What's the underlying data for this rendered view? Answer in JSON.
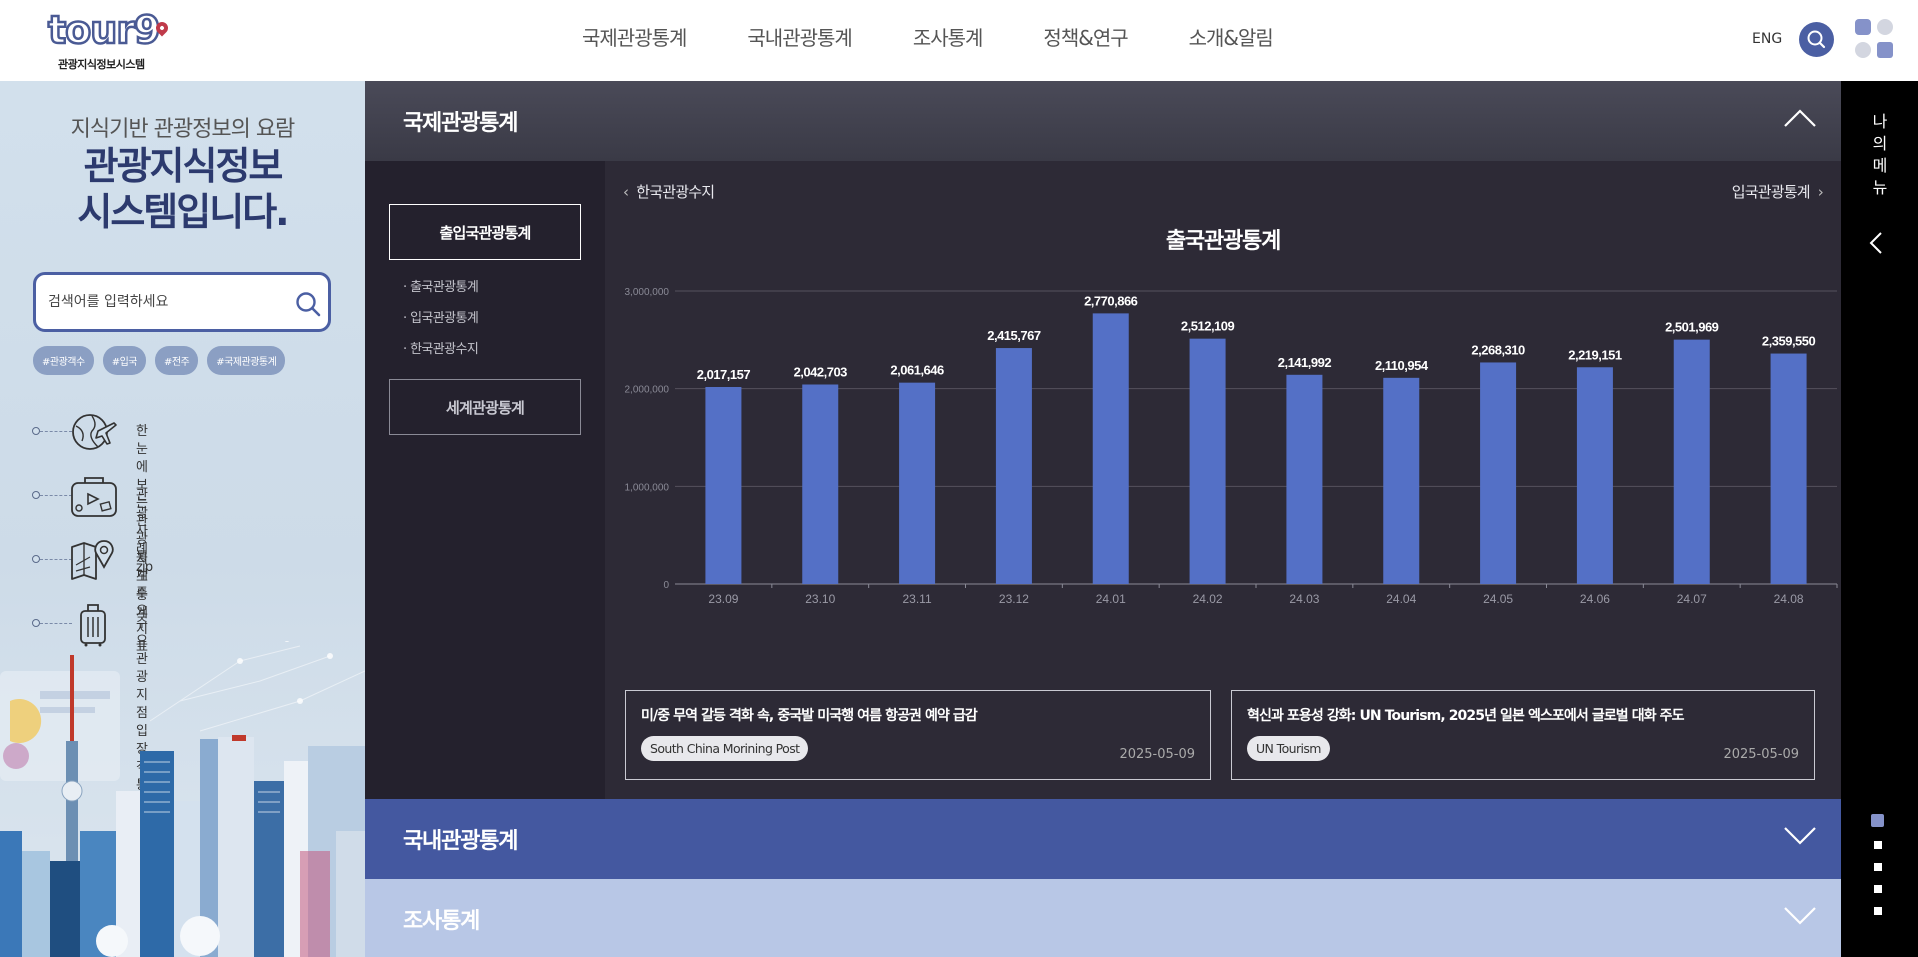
{
  "header": {
    "logo_text": "tour9",
    "logo_sub": "관광지식정보시스템",
    "nav": [
      "국제관광통계",
      "국내관광통계",
      "조사통계",
      "정책&연구",
      "소개&알림"
    ],
    "lang": "ENG"
  },
  "left": {
    "subtitle": "지식기반 관광정보의 요람",
    "title": "관광지식정보\n시스템입니다.",
    "search_placeholder": "검색어를 입력하세요",
    "tags": [
      "#관광객수",
      "#입국",
      "#전주",
      "#국제관광통계"
    ],
    "quick_links": [
      {
        "label": "한눈에보는관광통계주요지표",
        "icon": "globe-airplane-icon"
      },
      {
        "label": "관광사례zip",
        "icon": "suitcase-icon"
      },
      {
        "label": "지도통계",
        "icon": "map-pin-icon"
      },
      {
        "label": "주요관광지점\n입장객통계",
        "icon": "luggage-icon"
      }
    ]
  },
  "sections": {
    "international": "국제관광통계",
    "domestic": "국내관광통계",
    "survey": "조사통계"
  },
  "subnav": {
    "active": "출입국관광통계",
    "links": [
      "· 출국관광통계",
      "· 입국관광통계",
      "· 한국관광수지"
    ],
    "inactive": "세계관광통계"
  },
  "chart_nav": {
    "prev": "한국관광수지",
    "next": "입국관광통계"
  },
  "chart_data": {
    "type": "bar",
    "title": "출국관광통계",
    "categories": [
      "23.09",
      "23.10",
      "23.11",
      "23.12",
      "24.01",
      "24.02",
      "24.03",
      "24.04",
      "24.05",
      "24.06",
      "24.07",
      "24.08"
    ],
    "values": [
      2017157,
      2042703,
      2061646,
      2415767,
      2770866,
      2512109,
      2141992,
      2110954,
      2268310,
      2219151,
      2501969,
      2359550
    ],
    "value_labels": [
      "2,017,157",
      "2,042,703",
      "2,061,646",
      "2,415,767",
      "2,770,866",
      "2,512,109",
      "2,141,992",
      "2,110,954",
      "2,268,310",
      "2,219,151",
      "2,501,969",
      "2,359,550"
    ],
    "ylim": [
      0,
      3000000
    ],
    "yticks": [
      0,
      1000000,
      2000000,
      3000000
    ],
    "ytick_labels": [
      "0",
      "1,000,000",
      "2,000,000",
      "3,000,000"
    ],
    "grid": true,
    "bar_color": "#5470c6"
  },
  "news": [
    {
      "title": "미/중 무역 갈등 격화 속, 중국발 미국행 여름 항공권 예약 급감",
      "source": "South China Morining Post",
      "date": "2025-05-09"
    },
    {
      "title": "혁신과 포용성 강화: UN Tourism, 2025년 일본 엑스포에서 글로벌 대화 주도",
      "source": "UN Tourism",
      "date": "2025-05-09"
    }
  ],
  "rightbar": {
    "label": "나\n의\n메\n뉴"
  }
}
